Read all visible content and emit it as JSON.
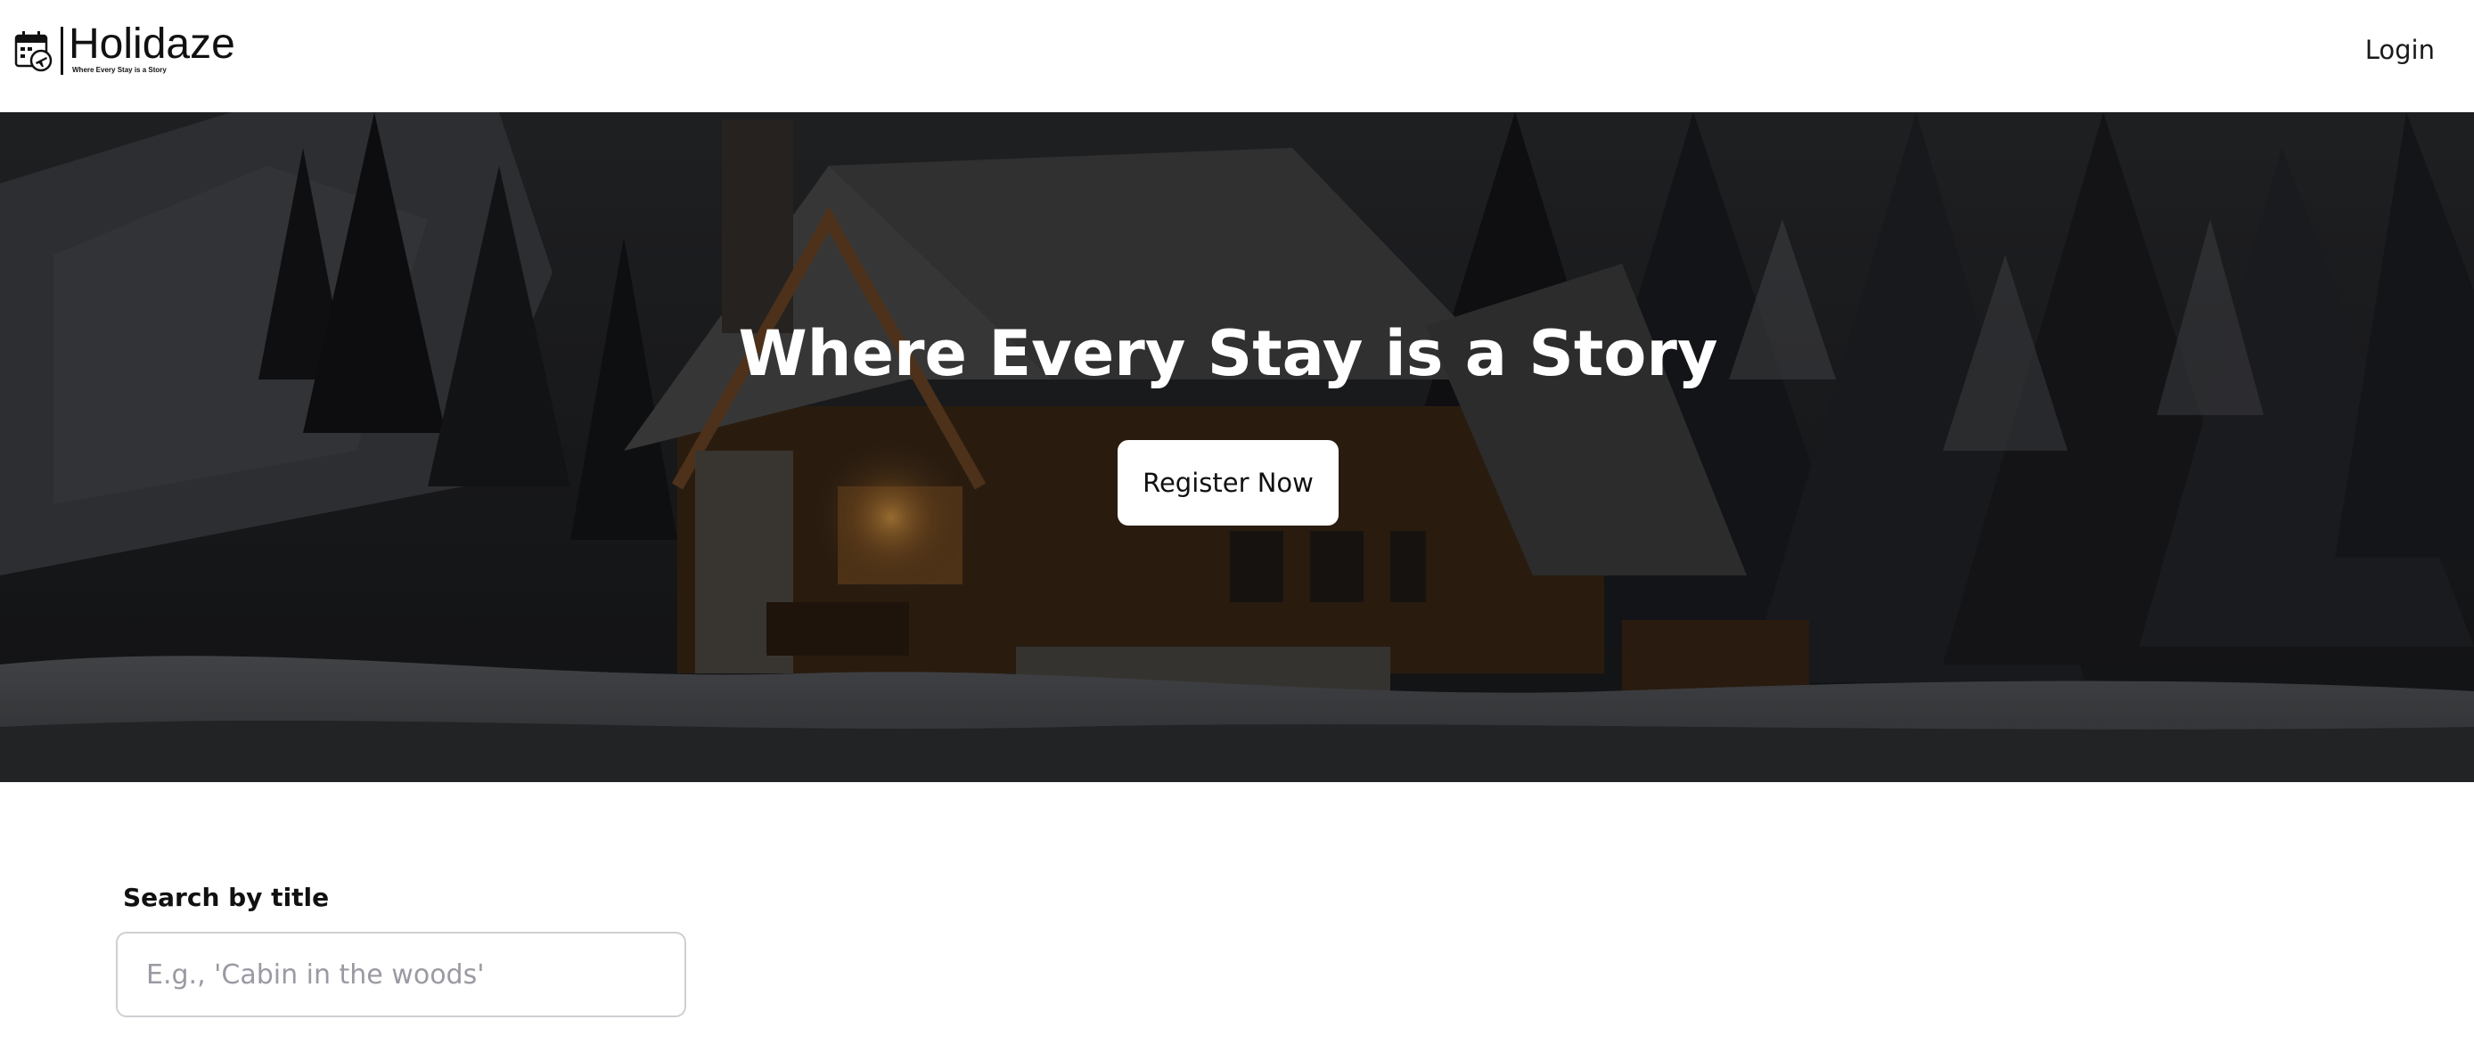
{
  "header": {
    "logo_title": "Holidaze",
    "logo_tagline": "Where Every Stay is a Story",
    "login_label": "Login"
  },
  "hero": {
    "title": "Where Every Stay is a Story",
    "register_label": "Register Now"
  },
  "search": {
    "label": "Search by title",
    "placeholder": "E.g., 'Cabin in the woods'",
    "value": ""
  },
  "colors": {
    "text": "#111111",
    "hero_overlay": "#1c1d1f",
    "button_bg": "#ffffff",
    "input_border": "#cfcfd4",
    "placeholder": "#9a9aa3"
  },
  "icons": {
    "logo": "calendar-airplane-icon"
  }
}
